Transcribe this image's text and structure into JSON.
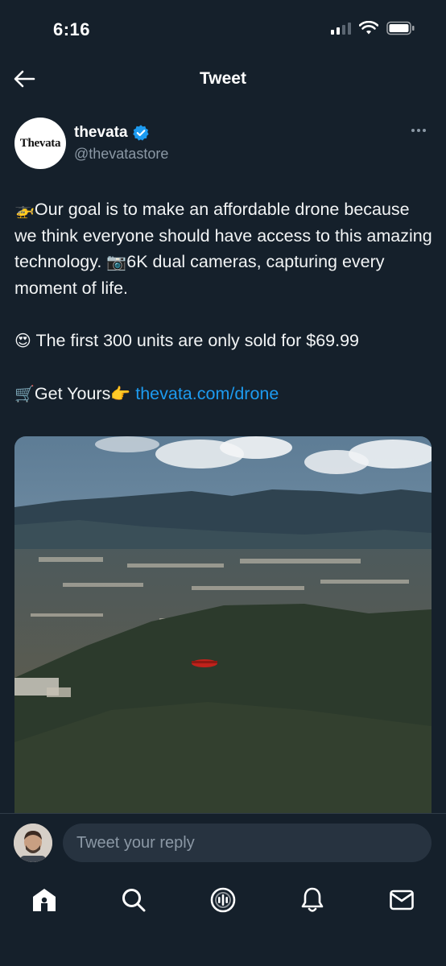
{
  "status_bar": {
    "time": "6:16"
  },
  "header": {
    "title": "Tweet"
  },
  "author": {
    "avatar_text": "Thevata",
    "display_name": "thevata",
    "handle": "@thevatastore",
    "verified": true
  },
  "tweet": {
    "line1_emoji": "🚁",
    "line1": "Our goal is to make an affordable drone because we think everyone should have access to this amazing technology. ",
    "line1_emoji2": "📷",
    "line1_tail": "6K dual cameras, capturing every moment of life.",
    "line2_emoji": "😍",
    "line2": " The first 300 units are only sold for $69.99",
    "line3_emoji": "🛒",
    "line3": "Get Yours",
    "line3_emoji2": "👉",
    "link": "thevata.com/drone"
  },
  "reply": {
    "placeholder": "Tweet your reply"
  },
  "nav": {
    "items": [
      "home-icon",
      "search-icon",
      "spaces-icon",
      "notifications-icon",
      "messages-icon"
    ]
  },
  "colors": {
    "background": "#15202b",
    "accent": "#1d9bf0",
    "muted": "#8b98a5",
    "verified": "#1d9bf0"
  }
}
